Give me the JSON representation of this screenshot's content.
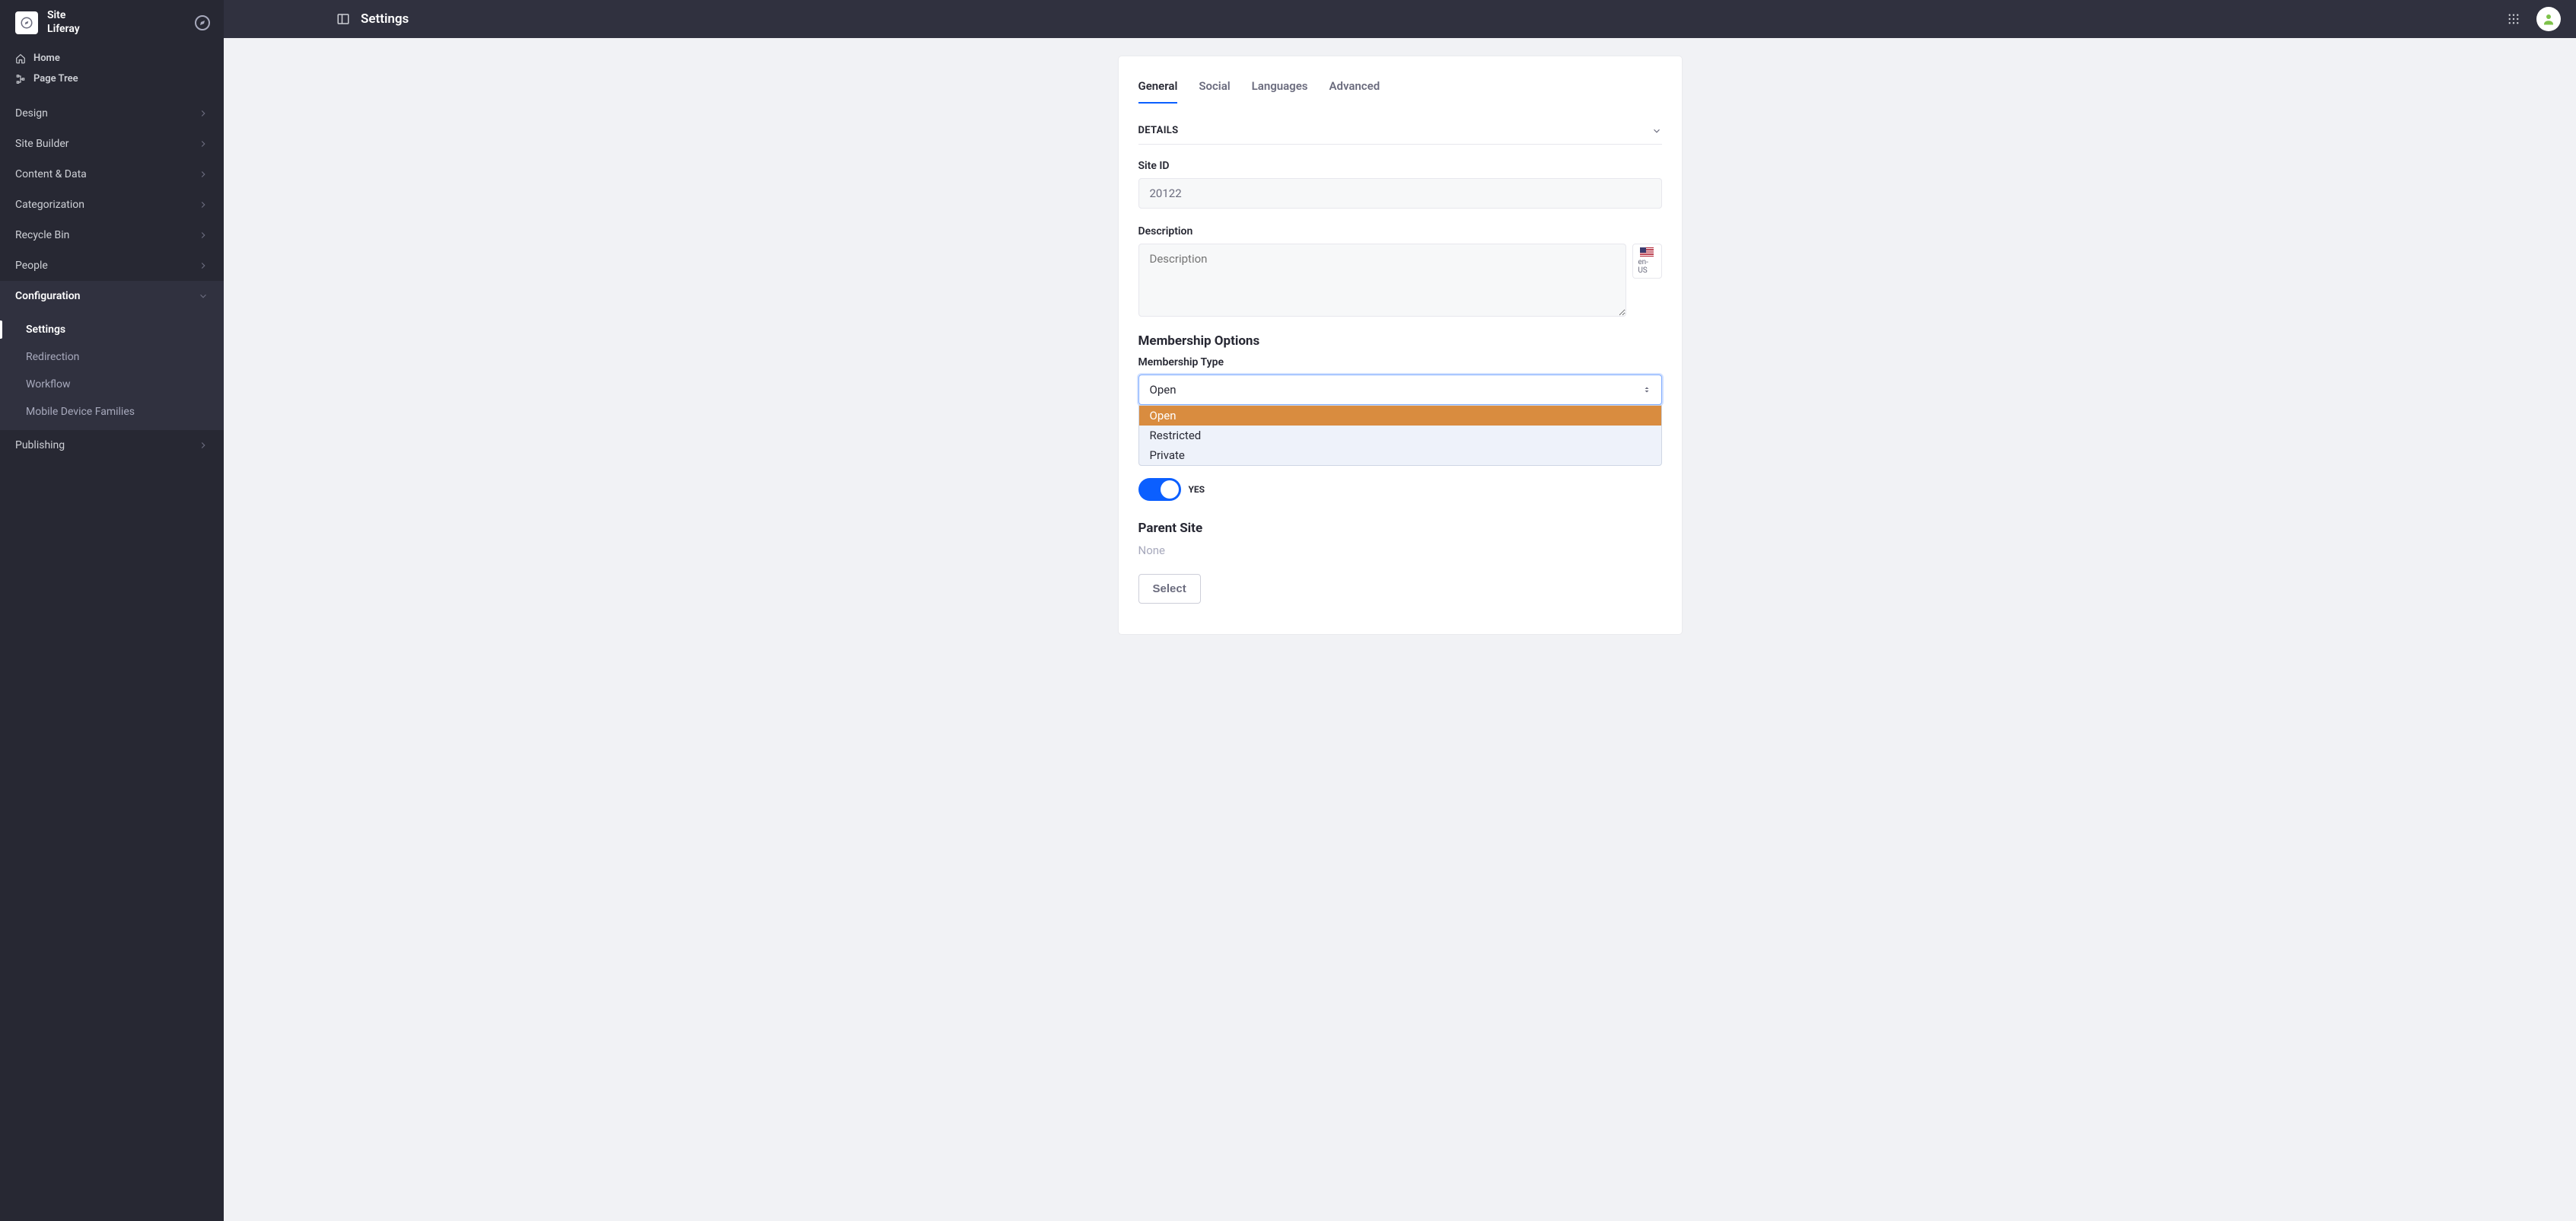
{
  "sidebar": {
    "site_label": "Site",
    "site_name": "Liferay",
    "quick_links": {
      "home": "Home",
      "page_tree": "Page Tree"
    },
    "items": [
      {
        "label": "Design",
        "expanded": false
      },
      {
        "label": "Site Builder",
        "expanded": false
      },
      {
        "label": "Content & Data",
        "expanded": false
      },
      {
        "label": "Categorization",
        "expanded": false
      },
      {
        "label": "Recycle Bin",
        "expanded": false
      },
      {
        "label": "People",
        "expanded": false
      },
      {
        "label": "Configuration",
        "expanded": true
      },
      {
        "label": "Publishing",
        "expanded": false
      }
    ],
    "configuration_children": [
      {
        "label": "Settings",
        "active": true
      },
      {
        "label": "Redirection",
        "active": false
      },
      {
        "label": "Workflow",
        "active": false
      },
      {
        "label": "Mobile Device Families",
        "active": false
      }
    ]
  },
  "topbar": {
    "title": "Settings"
  },
  "tabs": [
    {
      "label": "General",
      "active": true
    },
    {
      "label": "Social",
      "active": false
    },
    {
      "label": "Languages",
      "active": false
    },
    {
      "label": "Advanced",
      "active": false
    }
  ],
  "details": {
    "section_title": "DETAILS",
    "site_id_label": "Site ID",
    "site_id_value": "20122",
    "description_label": "Description",
    "description_placeholder": "Description",
    "description_value": "",
    "lang_code": "en-US"
  },
  "membership": {
    "section_title": "Membership Options",
    "type_label": "Membership Type",
    "type_value": "Open",
    "type_options": [
      "Open",
      "Restricted",
      "Private"
    ],
    "toggle_value": "YES"
  },
  "parent_site": {
    "section_title": "Parent Site",
    "value": "None",
    "select_button": "Select"
  }
}
